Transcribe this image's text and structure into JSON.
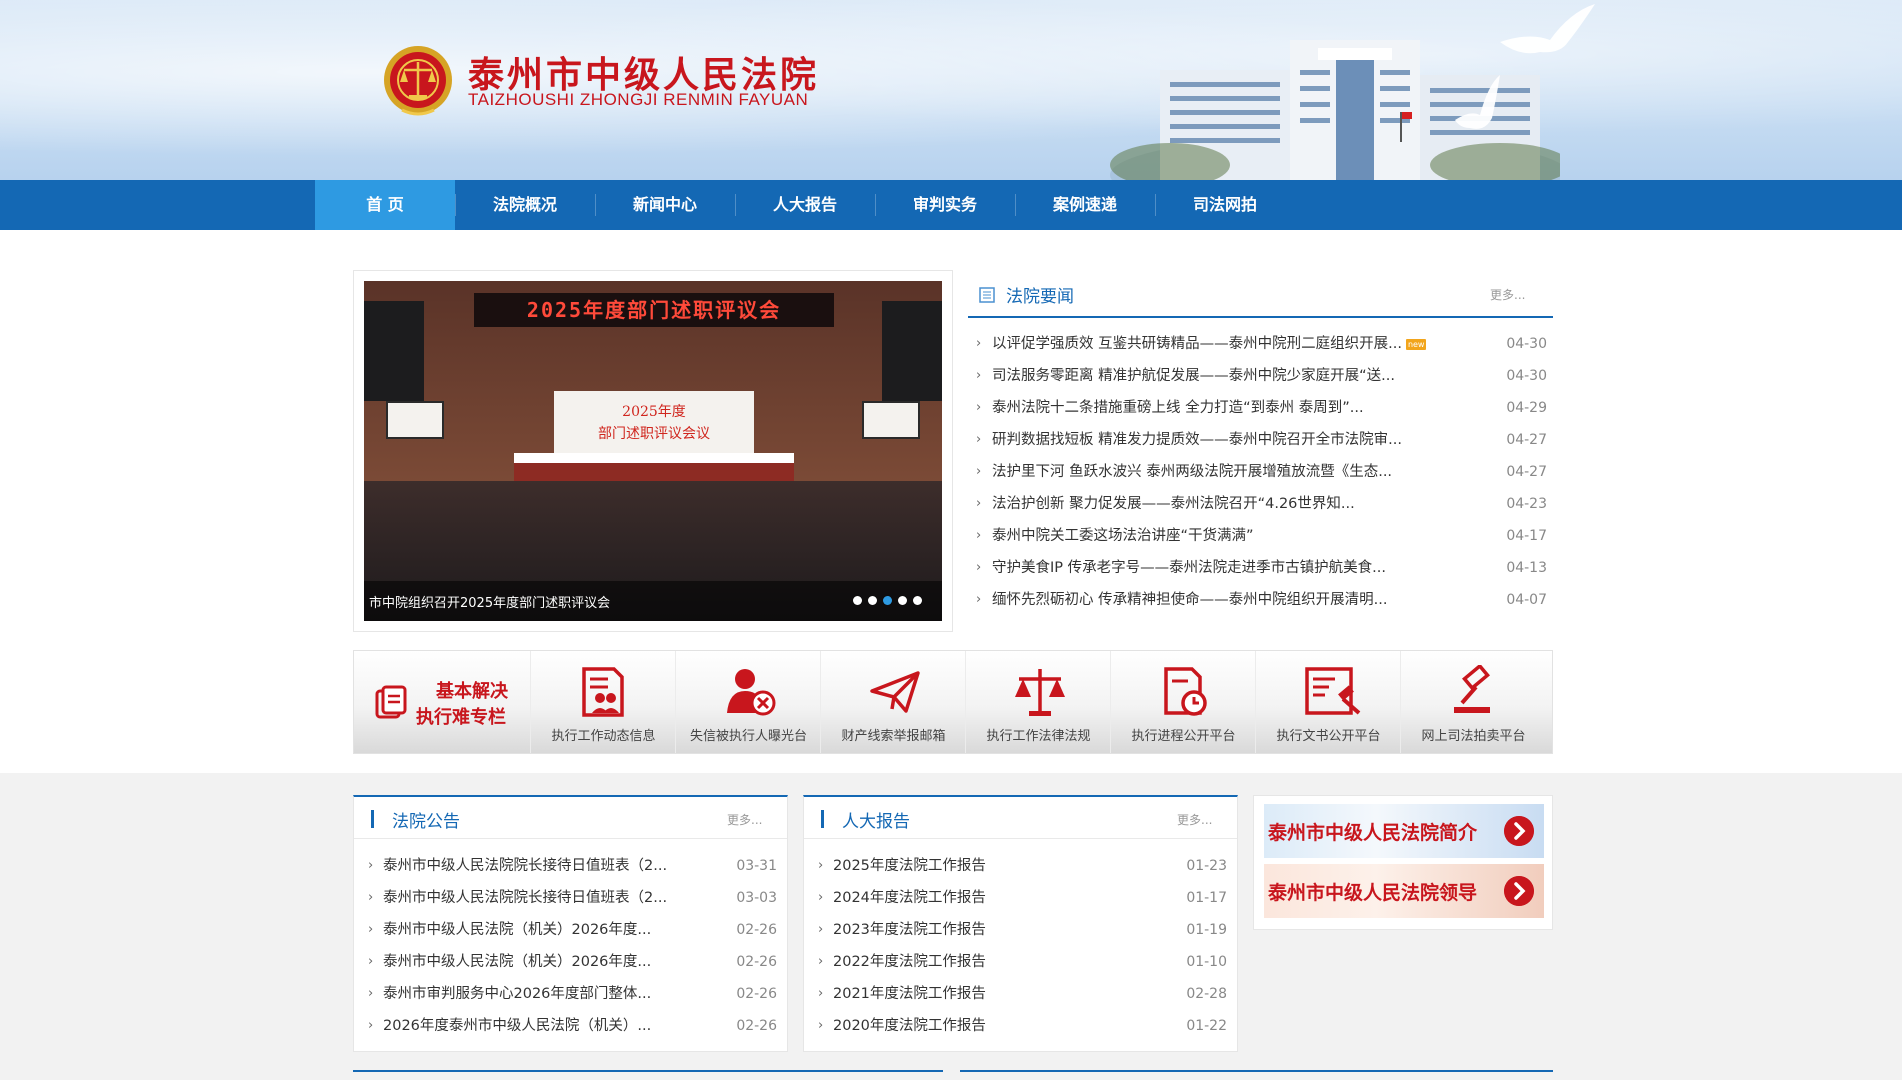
{
  "header": {
    "court_name": "泰州市中级人民法院",
    "court_pinyin": "TAIZHOUSHI ZHONGJI RENMIN FAYUAN"
  },
  "nav": {
    "items": [
      "首 页",
      "法院概况",
      "新闻中心",
      "人大报告",
      "审判实务",
      "案例速递",
      "司法网拍"
    ],
    "active_index": 0
  },
  "slider": {
    "led_text": "2025年度部门述职评议会",
    "board_line1": "2025年度",
    "board_line2": "部门述职评议会议",
    "caption": "市中院组织召开2025年度部门述职评议会",
    "dot_count": 5,
    "active_dot": 2
  },
  "news": {
    "title": "法院要闻",
    "more": "更多...",
    "new_badge": "new",
    "items": [
      {
        "text": "以评促学强质效 互鉴共研铸精品——泰州中院刑二庭组织开展...",
        "date": "04-30",
        "is_new": true
      },
      {
        "text": "司法服务零距离 精准护航促发展——泰州中院少家庭开展“送...",
        "date": "04-30"
      },
      {
        "text": "泰州法院十二条措施重磅上线 全力打造“到泰州 泰周到”...",
        "date": "04-29"
      },
      {
        "text": "研判数据找短板 精准发力提质效——泰州中院召开全市法院审...",
        "date": "04-27"
      },
      {
        "text": "法护里下河 鱼跃水波兴 泰州两级法院开展增殖放流暨《生态...",
        "date": "04-27"
      },
      {
        "text": "法治护创新 聚力促发展——泰州法院召开“4.26世界知...",
        "date": "04-23"
      },
      {
        "text": "泰州中院关工委这场法治讲座“干货满满”",
        "date": "04-17"
      },
      {
        "text": "守护美食IP 传承老字号——泰州法院走进季市古镇护航美食...",
        "date": "04-13"
      },
      {
        "text": "缅怀先烈砺初心 传承精神担使命——泰州中院组织开展清明...",
        "date": "04-07"
      }
    ]
  },
  "execution": {
    "title_line1": "基本解决",
    "title_line2": "执行难专栏",
    "items": [
      {
        "label": "执行工作动态信息",
        "icon": "person-document-icon"
      },
      {
        "label": "失信被执行人曝光台",
        "icon": "person-blocked-icon"
      },
      {
        "label": "财产线索举报邮箱",
        "icon": "paper-plane-icon"
      },
      {
        "label": "执行工作法律法规",
        "icon": "scales-icon"
      },
      {
        "label": "执行进程公开平台",
        "icon": "document-clock-icon"
      },
      {
        "label": "执行文书公开平台",
        "icon": "document-gavel-icon"
      },
      {
        "label": "网上司法拍卖平台",
        "icon": "gavel-icon"
      }
    ]
  },
  "announcements": {
    "title": "法院公告",
    "more": "更多...",
    "items": [
      {
        "text": "泰州市中级人民法院院长接待日值班表（2...",
        "date": "03-31"
      },
      {
        "text": "泰州市中级人民法院院长接待日值班表（2...",
        "date": "03-03"
      },
      {
        "text": "泰州市中级人民法院（机关）2026年度...",
        "date": "02-26"
      },
      {
        "text": "泰州市中级人民法院（机关）2026年度...",
        "date": "02-26"
      },
      {
        "text": "泰州市审判服务中心2026年度部门整体...",
        "date": "02-26"
      },
      {
        "text": "2026年度泰州市中级人民法院（机关）...",
        "date": "02-26"
      }
    ]
  },
  "reports": {
    "title": "人大报告",
    "more": "更多...",
    "items": [
      {
        "text": "2025年度法院工作报告",
        "date": "01-23"
      },
      {
        "text": "2024年度法院工作报告",
        "date": "01-17"
      },
      {
        "text": "2023年度法院工作报告",
        "date": "01-19"
      },
      {
        "text": "2022年度法院工作报告",
        "date": "01-10"
      },
      {
        "text": "2021年度法院工作报告",
        "date": "02-28"
      },
      {
        "text": "2020年度法院工作报告",
        "date": "01-22"
      }
    ]
  },
  "side_links": [
    {
      "label": "泰州市中级人民法院简介"
    },
    {
      "label": "泰州市中级人民法院领导"
    }
  ],
  "colors": {
    "nav_blue": "#1468b4",
    "nav_active": "#2e9ae2",
    "brand_red": "#c8161d"
  }
}
